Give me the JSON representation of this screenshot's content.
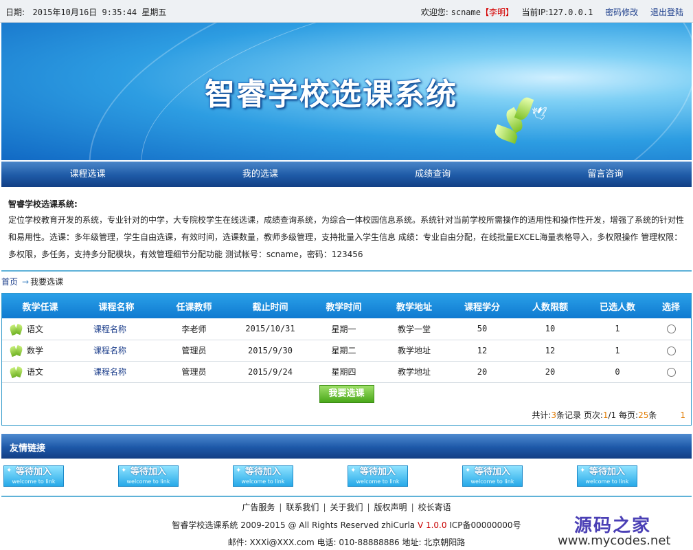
{
  "topbar": {
    "date_label": "日期:",
    "date_value": "2015年10月16日 9:35:44 星期五",
    "welcome_label": "欢迎您:",
    "account": "scname",
    "username_bracketed": "【李明】",
    "ip_label": "当前IP:",
    "ip_value": "127.0.0.1",
    "change_password": "密码修改",
    "logout": "退出登陆"
  },
  "banner": {
    "title": "智睿学校选课系统"
  },
  "nav": {
    "items": [
      "课程选课",
      "我的选课",
      "成绩查询",
      "留言咨询"
    ]
  },
  "intro": {
    "heading": "智睿学校选课系统:",
    "line1": "定位学校教育开发的系统，专业针对的中学，大专院校学生在线选课，成绩查询系统，为综合一体校园信息系统。系统针对当前学校所需操作的适用性和操作性开发，增强了系统的针对性",
    "line2": "和易用性。选课：多年级管理，学生自由选课，有效时间，选课数量，教师多级管理，支持批量入学生信息 成绩：专业自由分配，在线批量EXCEL海量表格导入，多权限操作 管理权限：",
    "line3": "多权限，多任务，支持多分配模块，有效管理细节分配功能 测试帐号：scname，密码：123456"
  },
  "breadcrumb": {
    "home": "首页",
    "arrow": "→",
    "current": "我要选课"
  },
  "table": {
    "headers": [
      "教学任课",
      "课程名称",
      "任课教师",
      "截止时间",
      "教学时间",
      "教学地址",
      "课程学分",
      "人数限额",
      "已选人数",
      "选择"
    ],
    "rows": [
      {
        "subject": "语文",
        "course": "课程名称",
        "teacher": "李老师",
        "deadline": "2015/10/31",
        "time": "星期一",
        "place": "教学一堂",
        "credit": "50",
        "limit": "10",
        "chosen": "1"
      },
      {
        "subject": "数学",
        "course": "课程名称",
        "teacher": "管理员",
        "deadline": "2015/9/30",
        "time": "星期二",
        "place": "教学地址",
        "credit": "12",
        "limit": "12",
        "chosen": "1"
      },
      {
        "subject": "语文",
        "course": "课程名称",
        "teacher": "管理员",
        "deadline": "2015/9/24",
        "time": "星期四",
        "place": "教学地址",
        "credit": "20",
        "limit": "20",
        "chosen": "0"
      }
    ],
    "submit_label": "我要选课"
  },
  "pager": {
    "total_label": "共计:",
    "total_value": "3",
    "records_label": "条记录 页次:",
    "page_current": "1",
    "page_sep": "/1 每页:",
    "per_page": "25",
    "per_page_unit": "条",
    "page_link": "1"
  },
  "friend_links": {
    "title": "友情链接",
    "button_text": "等待加入",
    "button_sub": "welcome to link",
    "count": 6
  },
  "footer": {
    "links": [
      "广告服务",
      "联系我们",
      "关于我们",
      "版权声明",
      "校长寄语"
    ],
    "separator": "|",
    "copy_prefix": "智睿学校选课系统 2009-2015 @ All Rights Reserved zhiCurla ",
    "version": "V 1.0.0",
    "icp": " ICP备00000000号",
    "contact": "邮件: XXXi@XXX.com 电话: 010-88888886   地址: 北京朝阳路"
  },
  "watermark": {
    "cn": "源码之家",
    "url": "www.mycodes.net"
  },
  "colors": {
    "nav": "#1e5aa6",
    "table_header": "#1a8ee0",
    "accent_red": "#d40000",
    "pager_num": "#e07a00",
    "submit": "#4aa81a"
  }
}
